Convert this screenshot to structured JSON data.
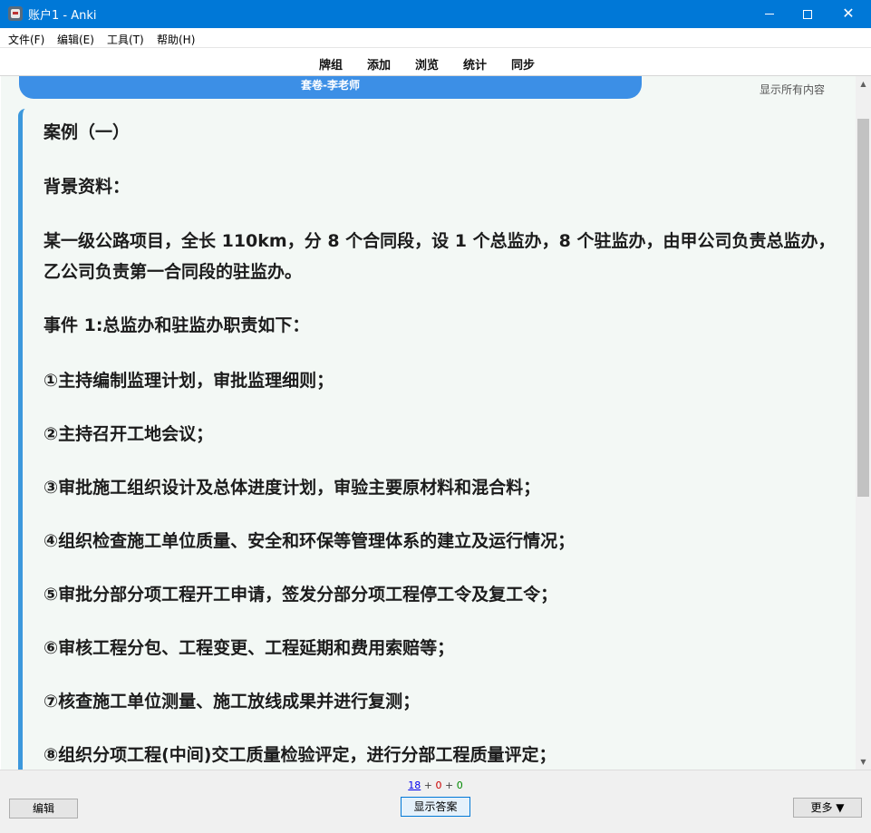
{
  "window": {
    "title": "账户1 - Anki",
    "app_icon": "anki-icon",
    "controls": [
      "minimize",
      "maximize",
      "close"
    ]
  },
  "menu": {
    "items": [
      {
        "label": "文件(F)"
      },
      {
        "label": "编辑(E)"
      },
      {
        "label": "工具(T)"
      },
      {
        "label": "帮助(H)"
      }
    ]
  },
  "toolbar": {
    "items": [
      {
        "label": "牌组"
      },
      {
        "label": "添加"
      },
      {
        "label": "浏览"
      },
      {
        "label": "统计"
      },
      {
        "label": "同步"
      }
    ]
  },
  "card": {
    "deck_banner": "套卷-李老师",
    "show_all": "显示所有内容",
    "lines": [
      "案例（一）",
      "背景资料：",
      "某一级公路项目，全长 110km，分 8 个合同段，设 1 个总监办，8 个驻监办，由甲公司负责总监办，乙公司负责第一合同段的驻监办。",
      "事件 1:总监办和驻监办职责如下：",
      "①主持编制监理计划，审批监理细则；",
      "②主持召开工地会议；",
      "③审批施工组织设计及总体进度计划，审验主要原材料和混合料；",
      "④组织检查施工单位质量、安全和环保等管理体系的建立及运行情况；",
      "⑤审批分部分项工程开工申请，签发分部分项工程停工令及复工令；",
      "⑥审核工程分包、工程变更、工程延期和费用索赔等；",
      "⑦核查施工单位测量、施工放线成果并进行复测；",
      "⑧组织分项工程(中间)交工质量检验评定，进行分部工程质量评定；"
    ]
  },
  "bottom": {
    "counts": {
      "new": "18",
      "learn": "0",
      "review": "0",
      "separator": "+"
    },
    "edit_label": "编辑",
    "show_answer_label": "显示答案",
    "more_label": "更多 ▼"
  },
  "colors": {
    "titlebar": "#0078d7",
    "deck_banner": "#3c8fe6",
    "card_bg": "#f3f8f5",
    "card_border": "#3c98dc",
    "count_new": "#0000ee",
    "count_learn": "#cc0000",
    "count_review": "#008800"
  }
}
